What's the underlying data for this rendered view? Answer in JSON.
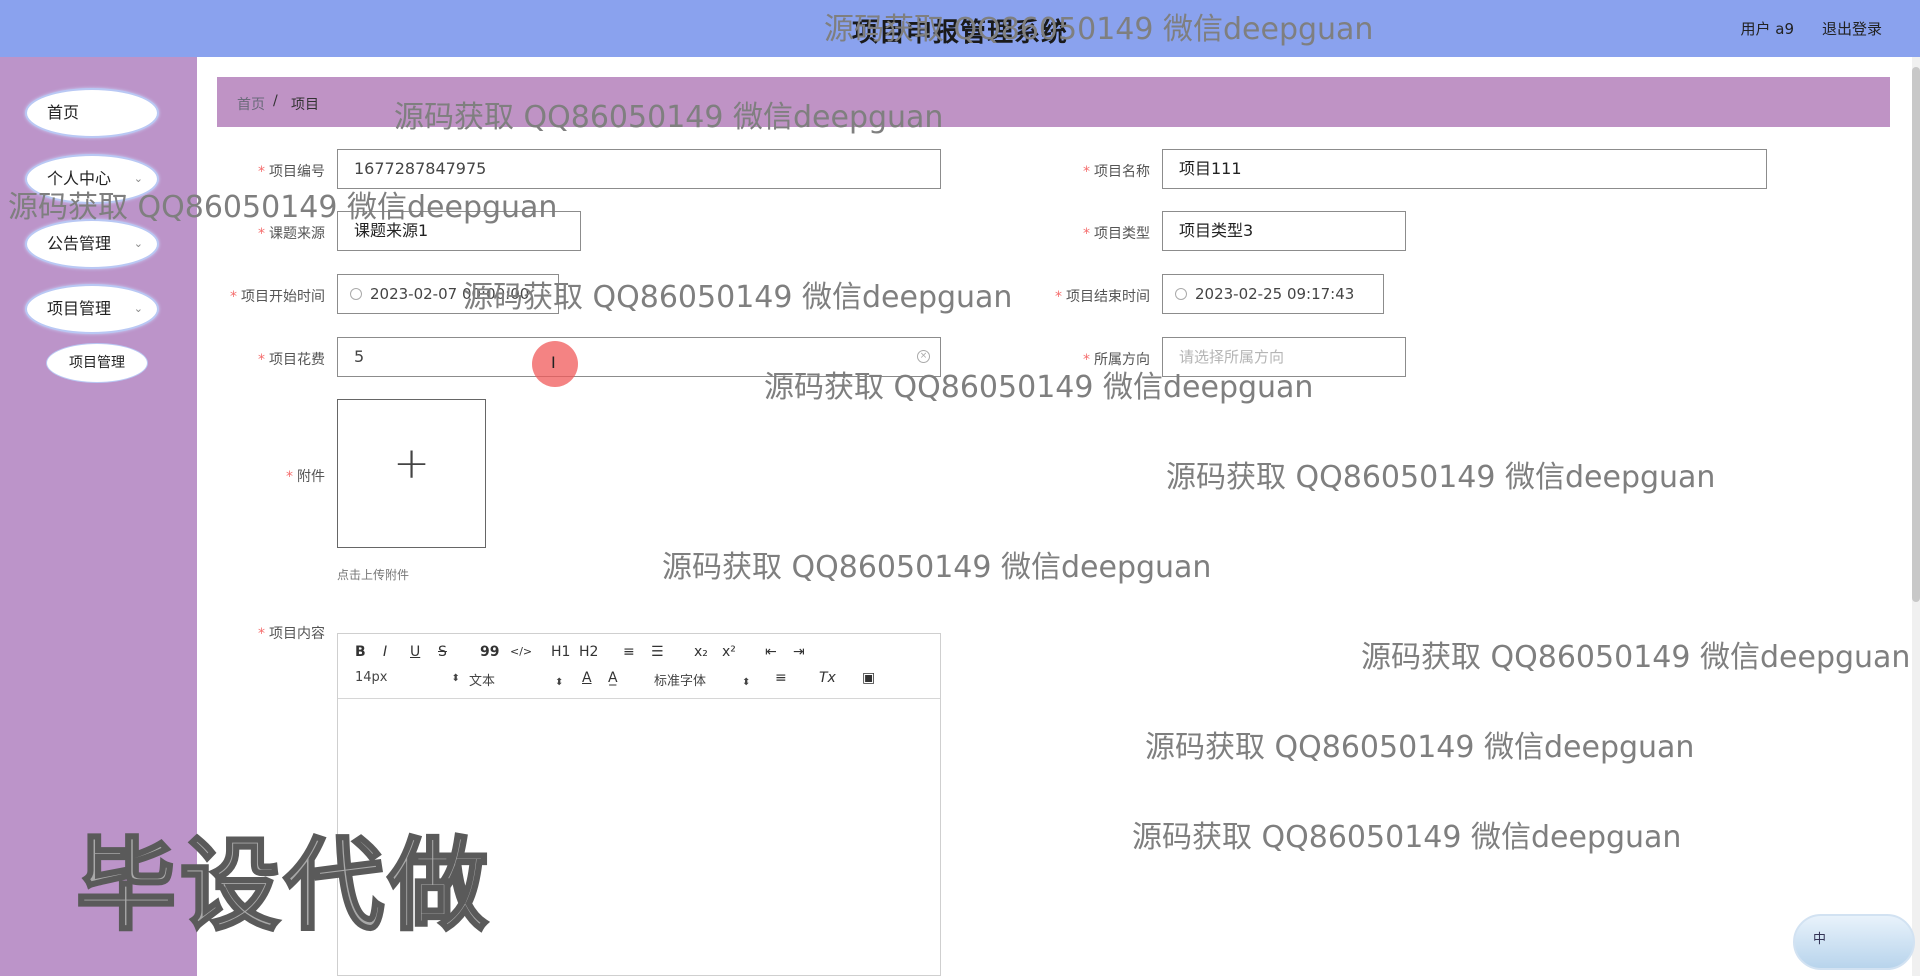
{
  "header": {
    "title": "项目申报管理系统",
    "user": "用户 a9",
    "logout": "退出登录"
  },
  "sidebar": {
    "items": [
      {
        "label": "首页"
      },
      {
        "label": "个人中心"
      },
      {
        "label": "公告管理"
      },
      {
        "label": "项目管理"
      }
    ],
    "sub_item": "项目管理",
    "chevron": "⌄"
  },
  "breadcrumb": {
    "home": "首页",
    "sep": "/",
    "current": "项目"
  },
  "form": {
    "project_no": {
      "label": "项目编号",
      "value": "1677287847975"
    },
    "project_name": {
      "label": "项目名称",
      "value": "项目111"
    },
    "source": {
      "label": "课题来源",
      "value": "课题来源1"
    },
    "type": {
      "label": "项目类型",
      "value": "项目类型3"
    },
    "start_time": {
      "label": "项目开始时间",
      "value": "2023-02-07 00:00:00"
    },
    "end_time": {
      "label": "项目结束时间",
      "value": "2023-02-25 09:17:43"
    },
    "cost": {
      "label": "项目花费",
      "value": "5"
    },
    "direction": {
      "label": "所属方向",
      "placeholder": "请选择所属方向"
    },
    "attachment": {
      "label": "附件",
      "tip": "点击上传附件",
      "plus": "+"
    },
    "content": {
      "label": "项目内容"
    }
  },
  "editor": {
    "row1": [
      "B",
      "I",
      "U",
      "S",
      "99",
      "</>",
      "H1",
      "H2",
      "≡",
      "☰",
      "x₂",
      "x²",
      "⇤",
      "⇥"
    ],
    "font_size": "14px",
    "header_type": "文本",
    "font_family": "标准字体",
    "row2_icons": [
      "A",
      "A̲",
      "≡",
      "Tx",
      "▣"
    ]
  },
  "ime": "中",
  "watermarks": {
    "text": "源码获取 QQ86050149 微信deepguan",
    "big": "毕设代做"
  },
  "colors": {
    "header": "#8aa2ee",
    "sidebar": "#bc94c9",
    "breadcrumb": "#bf93c5",
    "required": "#f56c6c"
  },
  "icons": {
    "clock": "clock-icon",
    "clear": "clear-icon",
    "upload": "plus-icon"
  }
}
